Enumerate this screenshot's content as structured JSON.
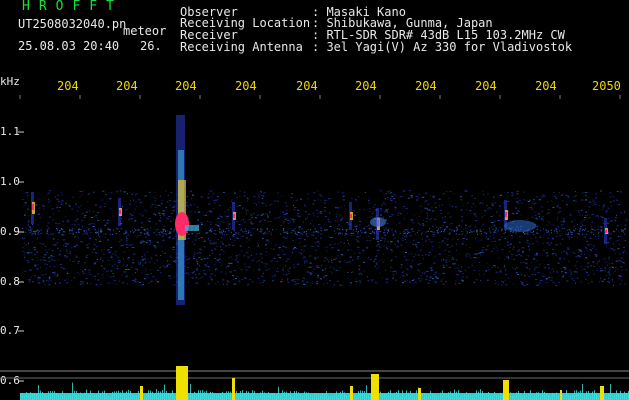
{
  "header": {
    "brand": "HROFFT",
    "filename": "UT2508032040.pn",
    "meteor_word": "meteor",
    "date_time": "25.08.03 20:40",
    "count": "26.",
    "observer_label": "Observer",
    "observer_value": ": Masaki Kano",
    "location_label": "Receiving Location",
    "location_value": ": Shibukawa, Gunma, Japan",
    "receiver_label": "Receiver",
    "receiver_value": ": RTL-SDR SDR# 43dB L15 103.2MHz CW",
    "antenna_label": "Receiving Antenna",
    "antenna_value": ": 3el Yagi(V) Az 330 for Vladivostok"
  },
  "axis": {
    "unit": "kHz",
    "y_ticks": [
      "1.1",
      "1.0",
      "0.9",
      "0.8",
      "0.7",
      "0.6"
    ],
    "x_ticks": [
      "204",
      "204",
      "204",
      "204",
      "204",
      "204",
      "204",
      "204",
      "204",
      "2050"
    ]
  },
  "colors": {
    "background": "#000000",
    "header_text": "#e8e8e8",
    "brand": "#17e03a",
    "tick_text": "#f0d800",
    "noise_band": "#2a3cc8",
    "meteor_core": "#ff2a6a",
    "activity_bars": "#f0e000",
    "baseline": "#33cccc"
  }
}
